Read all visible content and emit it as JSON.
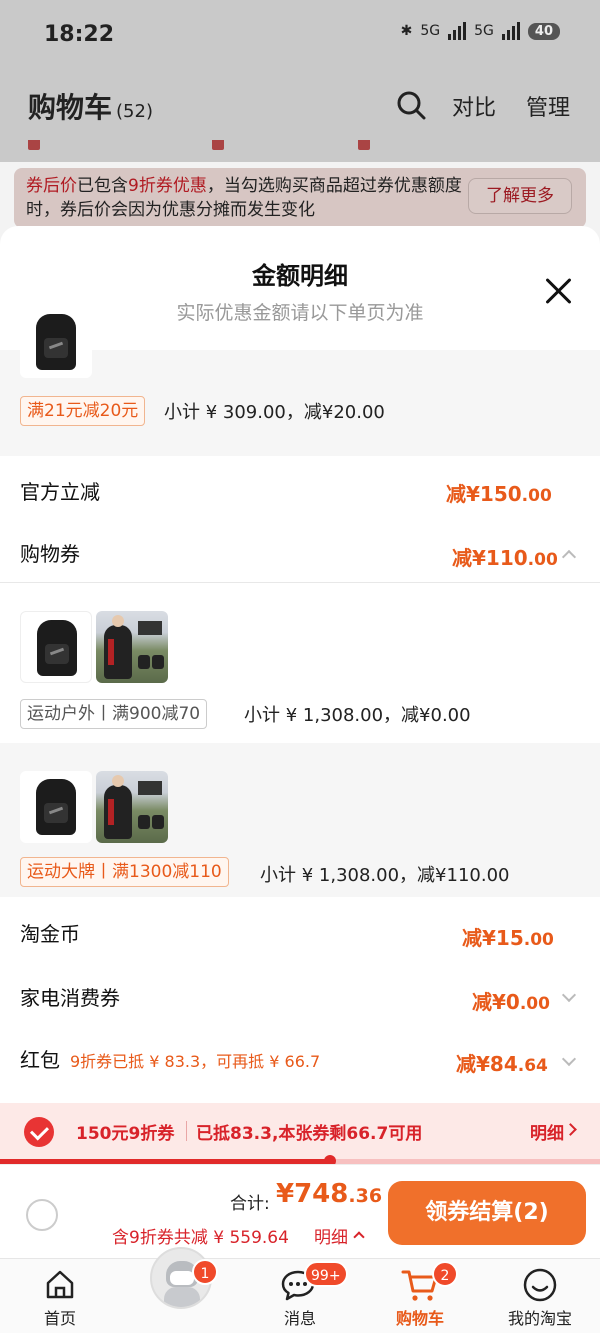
{
  "status_bar": {
    "time": "18:22",
    "network1": "5G",
    "network2": "5G",
    "battery": "40"
  },
  "header": {
    "title": "购物车",
    "count": "(52)",
    "compare": "对比",
    "manage": "管理"
  },
  "notice": {
    "part1": "券后价",
    "part2": "已包含",
    "part3": "9折券优惠",
    "part4": "，当勾选购买商品超过券优惠额度时，券后价会因为优惠分摊而发生变化",
    "learn_more": "了解更多"
  },
  "sheet": {
    "title": "金额明细",
    "subtitle": "实际优惠金额请以下单页为准",
    "group1": {
      "tag": "满21元减20元",
      "subtotal": "小计 ¥ 309.00，减¥20.00"
    },
    "official": {
      "label": "官方立减",
      "value_int": "减¥150",
      "value_dec": ".00"
    },
    "coupon": {
      "label": "购物券",
      "value_int": "减¥110",
      "value_dec": ".00"
    },
    "group2": {
      "tag": "运动户外丨满900减70",
      "subtotal": "小计 ¥ 1,308.00，减¥0.00"
    },
    "group3": {
      "tag": "运动大牌丨满1300减110",
      "subtotal": "小计 ¥ 1,308.00，减¥110.00"
    },
    "taojinbi": {
      "label": "淘金币",
      "value_int": "减¥15",
      "value_dec": ".00"
    },
    "appliance": {
      "label": "家电消费券",
      "value_int": "减¥0",
      "value_dec": ".00"
    },
    "hongbao": {
      "label": "红包",
      "note": "9折券已抵 ¥ 83.3，可再抵 ¥ 66.7",
      "value_int": "减¥84",
      "value_dec": ".64"
    }
  },
  "coupon_strip": {
    "name": "150元9折券",
    "desc": "已抵83.3,本张券剩66.7可用",
    "detail": "明细",
    "progress": 0.55
  },
  "checkout": {
    "total_label": "合计:",
    "total_int": "¥748",
    "total_dec": ".36",
    "saved": "含9折券共减 ¥ 559.64",
    "detail": "明细",
    "button": "领券结算(2)"
  },
  "tabbar": {
    "home": "首页",
    "avatar_badge": "1",
    "messages": "消息",
    "messages_badge": "99+",
    "cart": "购物车",
    "cart_badge": "2",
    "mine": "我的淘宝"
  },
  "colors": {
    "accent": "#e85a1a",
    "red": "#d8232a",
    "button": "#f0702b"
  }
}
